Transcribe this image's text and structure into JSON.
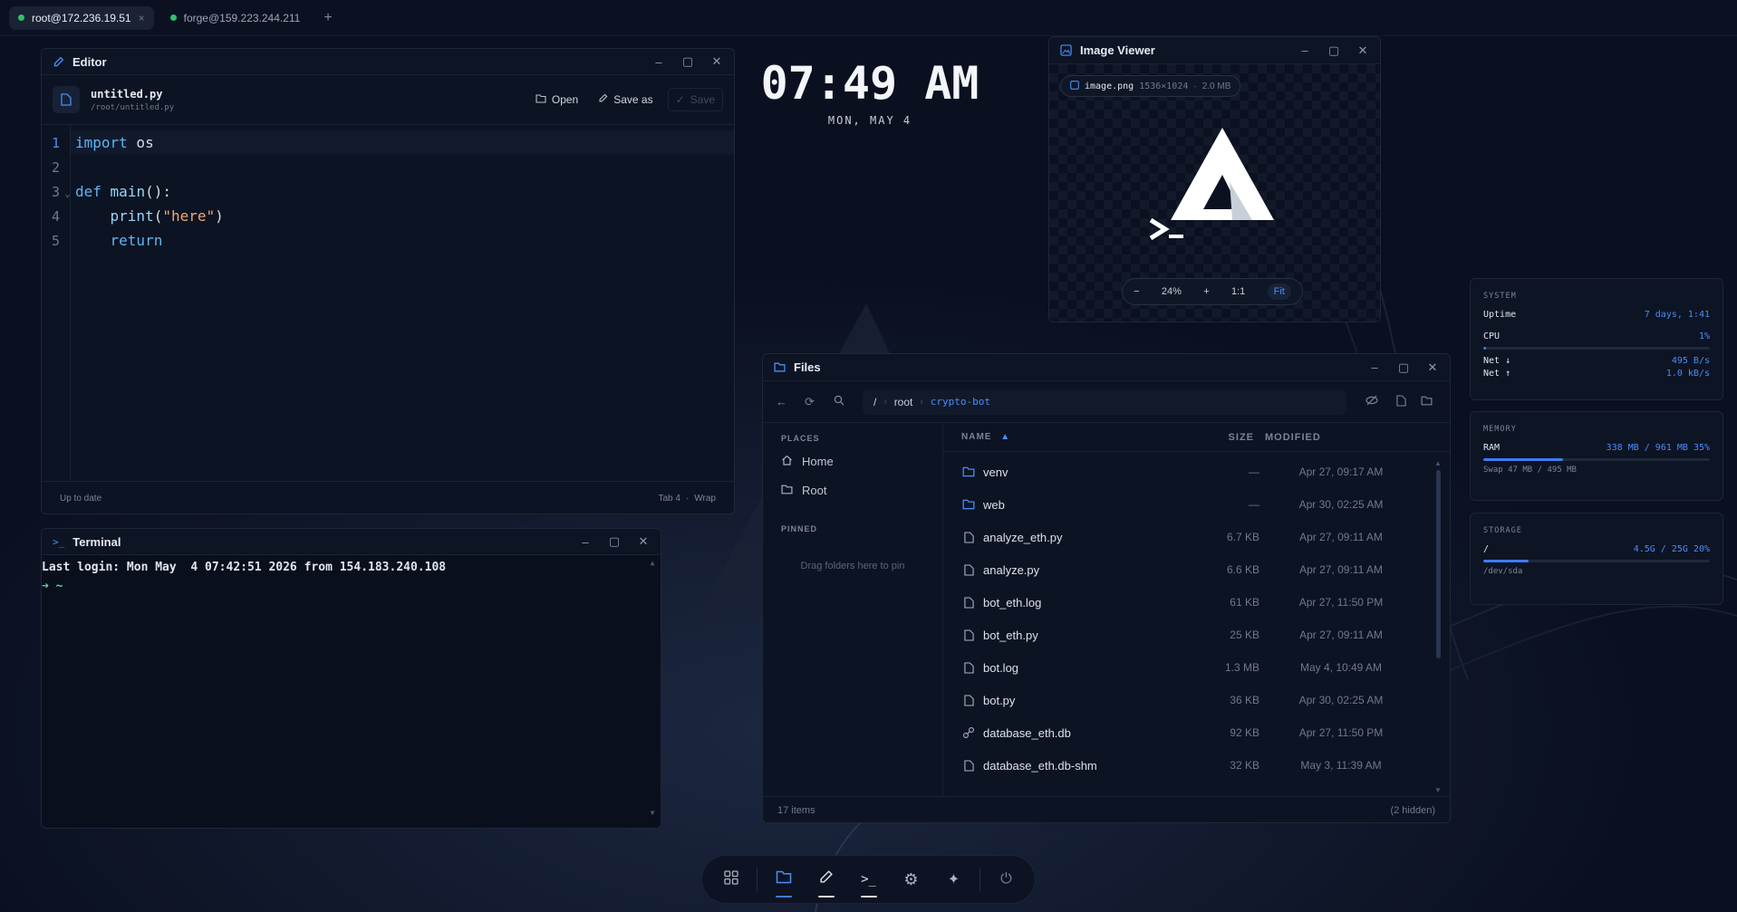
{
  "tabs": [
    {
      "label": "root@172.236.19.51",
      "close": "×"
    },
    {
      "label": "forge@159.223.244.211"
    }
  ],
  "tab_add": "+",
  "clock": {
    "time": "07:49 AM",
    "date": "MON, MAY 4"
  },
  "editor": {
    "title": "Editor",
    "filename": "untitled.py",
    "filepath": "/root/untitled.py",
    "open_label": "Open",
    "saveas_label": "Save as",
    "save_label": "Save",
    "lines": [
      {
        "n": "1",
        "tokens": [
          {
            "t": "import",
            "c": "kw"
          },
          {
            "t": " os",
            "c": "pl"
          }
        ]
      },
      {
        "n": "2",
        "tokens": []
      },
      {
        "n": "3",
        "fold": "⌄",
        "tokens": [
          {
            "t": "def",
            "c": "kw"
          },
          {
            "t": " ",
            "c": "pl"
          },
          {
            "t": "main",
            "c": "fn"
          },
          {
            "t": "():",
            "c": "pl"
          }
        ]
      },
      {
        "n": "4",
        "tokens": [
          {
            "t": "    ",
            "c": "pl"
          },
          {
            "t": "print",
            "c": "fn"
          },
          {
            "t": "(",
            "c": "pl"
          },
          {
            "t": "\"here\"",
            "c": "str"
          },
          {
            "t": ")",
            "c": "pl"
          }
        ]
      },
      {
        "n": "5",
        "tokens": [
          {
            "t": "    ",
            "c": "pl"
          },
          {
            "t": "return",
            "c": "kw"
          }
        ]
      }
    ],
    "status": "Up to date",
    "tab_info": "Tab 4",
    "sep": "·",
    "wrap": "Wrap"
  },
  "terminal": {
    "title": "Terminal",
    "line1": "Last login: Mon May  4 07:42:51 2026 from 154.183.240.108",
    "prompt_arrow": "➜",
    "prompt_path": "~"
  },
  "image_viewer": {
    "title": "Image Viewer",
    "file": "image.png",
    "dims": "1536×1024",
    "sep": "·",
    "size": "2.0 MB",
    "zoom_out": "−",
    "zoom": "24%",
    "zoom_in": "+",
    "one_to_one": "1:1",
    "fit": "Fit"
  },
  "files": {
    "title": "Files",
    "crumbs": [
      "/",
      "root",
      "crypto-bot"
    ],
    "places_header": "PLACES",
    "places": [
      "Home",
      "Root"
    ],
    "pinned_header": "PINNED",
    "pinned_hint": "Drag folders here to pin",
    "col_name": "NAME",
    "col_size": "SIZE",
    "col_modified": "MODIFIED",
    "rows": [
      {
        "name": "venv",
        "size": "—",
        "modified": "Apr 27, 09:17 AM",
        "type": "folder"
      },
      {
        "name": "web",
        "size": "—",
        "modified": "Apr 30, 02:25 AM",
        "type": "folder"
      },
      {
        "name": "analyze_eth.py",
        "size": "6.7 KB",
        "modified": "Apr 27, 09:11 AM",
        "type": "file"
      },
      {
        "name": "analyze.py",
        "size": "6.6 KB",
        "modified": "Apr 27, 09:11 AM",
        "type": "file"
      },
      {
        "name": "bot_eth.log",
        "size": "61 KB",
        "modified": "Apr 27, 11:50 PM",
        "type": "file"
      },
      {
        "name": "bot_eth.py",
        "size": "25 KB",
        "modified": "Apr 27, 09:11 AM",
        "type": "file"
      },
      {
        "name": "bot.log",
        "size": "1.3 MB",
        "modified": "May 4, 10:49 AM",
        "type": "file"
      },
      {
        "name": "bot.py",
        "size": "36 KB",
        "modified": "Apr 30, 02:25 AM",
        "type": "file"
      },
      {
        "name": "database_eth.db",
        "size": "92 KB",
        "modified": "Apr 27, 11:50 PM",
        "type": "db"
      },
      {
        "name": "database_eth.db-shm",
        "size": "32 KB",
        "modified": "May 3, 11:39 AM",
        "type": "file"
      }
    ],
    "item_count": "17 items",
    "hidden": "(2 hidden)"
  },
  "system": {
    "header": "SYSTEM",
    "uptime_label": "Uptime",
    "uptime": "7 days, 1:41",
    "cpu_label": "CPU",
    "cpu": "1%",
    "cpu_fraction": 0.01,
    "net_down_label": "Net ↓",
    "net_down": "495 B/s",
    "net_up_label": "Net ↑",
    "net_up": "1.0 kB/s"
  },
  "memory": {
    "header": "MEMORY",
    "ram_label": "RAM",
    "ram": "338 MB / 961 MB 35%",
    "ram_fraction": 0.35,
    "swap": "Swap 47 MB / 495 MB"
  },
  "storage": {
    "header": "STORAGE",
    "mount": "/",
    "usage": "4.5G / 25G 20%",
    "fraction": 0.2,
    "device": "/dev/sda"
  },
  "colors": {
    "accent": "#3d7df0",
    "success": "#31c06a",
    "prompt": "#5fd48a"
  }
}
